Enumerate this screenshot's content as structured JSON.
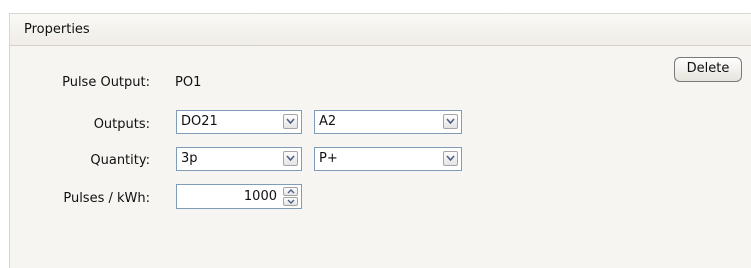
{
  "panel": {
    "title": "Properties"
  },
  "delete_button": {
    "label": "Delete"
  },
  "fields": {
    "pulse_output": {
      "label": "Pulse Output:",
      "value": "PO1"
    },
    "outputs": {
      "label": "Outputs:",
      "primary_value": "DO21",
      "secondary_value": "A2"
    },
    "quantity": {
      "label": "Quantity:",
      "primary_value": "3p",
      "secondary_value": "P+"
    },
    "pulses": {
      "label": "Pulses / kWh:",
      "value": "1000"
    }
  },
  "icons": {
    "dropdown": "chevron-down-icon",
    "spin_up": "arrow-up-icon",
    "spin_down": "arrow-down-icon"
  },
  "colors": {
    "panel_background": "#f6f5f1",
    "field_border": "#7f9db9"
  }
}
